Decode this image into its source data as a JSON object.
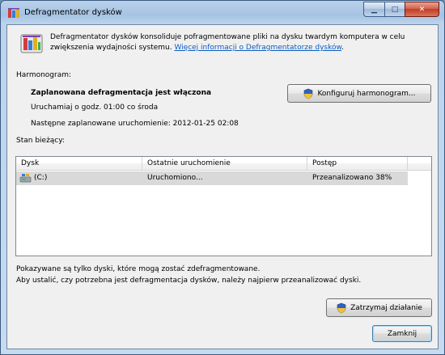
{
  "window": {
    "title": "Defragmentator dysków",
    "min_glyph": "▁",
    "max_glyph": "□",
    "close_glyph": "✕"
  },
  "intro": {
    "text_line1": "Defragmentator dysków konsoliduje pofragmentowane pliki na dysku twardym komputera w celu",
    "text_line2_prefix": "zwiększenia wydajności systemu. ",
    "link": "Więcej informacji o Defragmentatorze dysków",
    "text_line2_suffix": "."
  },
  "schedule": {
    "section_label": "Harmonogram:",
    "status": "Zaplanowana defragmentacja jest włączona",
    "run_at": "Uruchamiaj o godz. 01:00 co środa",
    "next_run": "Następne zaplanowane uruchomienie: 2012-01-25 02:08",
    "configure_button": "Konfiguruj harmonogram..."
  },
  "current": {
    "section_label": "Stan bieżący:",
    "columns": [
      "Dysk",
      "Ostatnie uruchomienie",
      "Postęp"
    ],
    "rows": [
      {
        "disk": "(C:)",
        "last_run": "Uruchomiono...",
        "progress": "Przeanalizowano 38%"
      }
    ]
  },
  "footer": {
    "note_line1": "Pokazywane są tylko dyski, które mogą zostać zdefragmentowane.",
    "note_line2": "Aby ustalić, czy potrzebna jest defragmentacja dysków, należy najpierw przeanalizować dyski.",
    "stop_button": "Zatrzymaj działanie",
    "close_button": "Zamknij"
  },
  "colors": {
    "link": "#0a5dc2",
    "selected_row": "#d9d9d9",
    "close_red": "#c23b22"
  },
  "icons": {
    "app": "defrag-app-icon",
    "shield": "uac-shield-icon",
    "disk": "hard-disk-icon"
  }
}
